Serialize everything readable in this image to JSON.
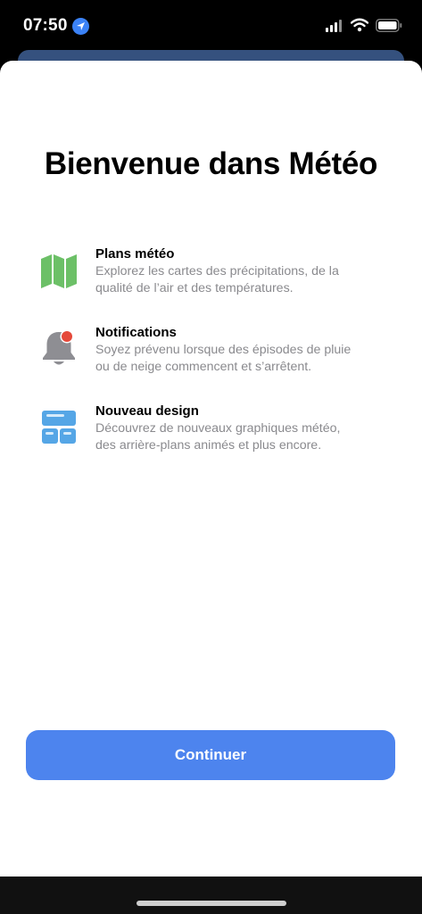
{
  "status_bar": {
    "time": "07:50",
    "icons": [
      "location-arrow-icon",
      "cellular-signal-icon",
      "wifi-icon",
      "battery-icon"
    ]
  },
  "sheet": {
    "title": "Bienvenue dans Météo",
    "features": [
      {
        "icon": "map-icon",
        "icon_color": "#6cc067",
        "title": "Plans météo",
        "description_line1": "Explorez les cartes des précipitations, de la",
        "description_line2": "qualité de l’air et des températures."
      },
      {
        "icon": "bell-badge-icon",
        "icon_color": "#8e8e93",
        "badge_color": "#e5493a",
        "title": "Notifications",
        "description_line1": "Soyez prévenu lorsque des épisodes de pluie",
        "description_line2": "ou de neige commencent et s’arrêtent."
      },
      {
        "icon": "widgets-layout-icon",
        "icon_color": "#55a6e6",
        "title": "Nouveau design",
        "description_line1": "Découvrez de nouveaux graphiques météo,",
        "description_line2": "des arrière-plans animés et plus encore."
      }
    ],
    "continue_label": "Continuer"
  },
  "colors": {
    "accent": "#4d84ee",
    "background_card": "#35517e"
  }
}
